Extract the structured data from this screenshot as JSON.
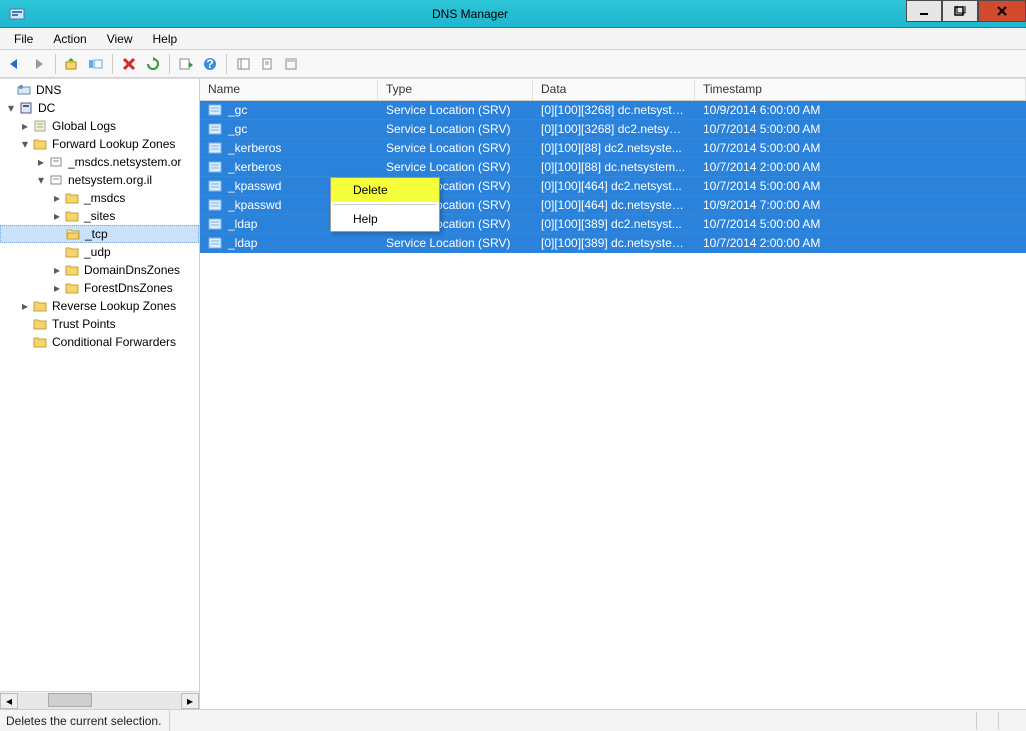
{
  "window": {
    "title": "DNS Manager"
  },
  "menu": {
    "file": "File",
    "action": "Action",
    "view": "View",
    "help": "Help"
  },
  "tree": {
    "root": "DNS",
    "dc": "DC",
    "global_logs": "Global Logs",
    "flz": "Forward Lookup Zones",
    "flz_msdcs": "_msdcs.netsystem.or",
    "flz_net": "netsystem.org.il",
    "flz_net_msdcs": "_msdcs",
    "flz_net_sites": "_sites",
    "flz_net_tcp": "_tcp",
    "flz_net_udp": "_udp",
    "flz_net_ddz": "DomainDnsZones",
    "flz_net_fdz": "ForestDnsZones",
    "rlz": "Reverse Lookup Zones",
    "trust": "Trust Points",
    "cond": "Conditional Forwarders"
  },
  "columns": {
    "name": "Name",
    "type": "Type",
    "data": "Data",
    "ts": "Timestamp"
  },
  "records": [
    {
      "name": "_gc",
      "type": "Service Location (SRV)",
      "data": "[0][100][3268] dc.netsyste...",
      "ts": "10/9/2014 6:00:00 AM"
    },
    {
      "name": "_gc",
      "type": "Service Location (SRV)",
      "data": "[0][100][3268] dc2.netsyst...",
      "ts": "10/7/2014 5:00:00 AM"
    },
    {
      "name": "_kerberos",
      "type": "Service Location (SRV)",
      "data": "[0][100][88] dc2.netsyste...",
      "ts": "10/7/2014 5:00:00 AM"
    },
    {
      "name": "_kerberos",
      "type": "Service Location (SRV)",
      "data": "[0][100][88] dc.netsystem...",
      "ts": "10/7/2014 2:00:00 AM"
    },
    {
      "name": "_kpasswd",
      "type": "Service Location (SRV)",
      "data": "[0][100][464] dc2.netsyst...",
      "ts": "10/7/2014 5:00:00 AM"
    },
    {
      "name": "_kpasswd",
      "type": "Service Location (SRV)",
      "data": "[0][100][464] dc.netsystem...",
      "ts": "10/9/2014 7:00:00 AM"
    },
    {
      "name": "_ldap",
      "type": "Service Location (SRV)",
      "data": "[0][100][389] dc2.netsyst...",
      "ts": "10/7/2014 5:00:00 AM"
    },
    {
      "name": "_ldap",
      "type": "Service Location (SRV)",
      "data": "[0][100][389] dc.netsystem...",
      "ts": "10/7/2014 2:00:00 AM"
    }
  ],
  "context_menu": {
    "delete": "Delete",
    "help": "Help"
  },
  "status": {
    "text": "Deletes the current selection."
  }
}
